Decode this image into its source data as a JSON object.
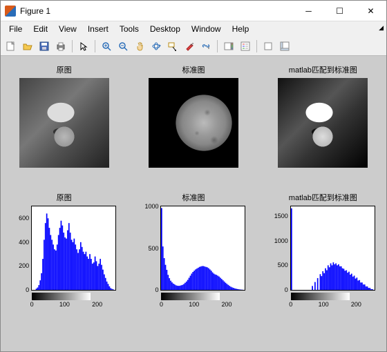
{
  "window": {
    "title": "Figure 1"
  },
  "menu": {
    "file": "File",
    "edit": "Edit",
    "view": "View",
    "insert": "Insert",
    "tools": "Tools",
    "desktop": "Desktop",
    "window": "Window",
    "help": "Help"
  },
  "subplots": {
    "img1": "原图",
    "img2": "标准图",
    "img3": "matlab匹配到标准图",
    "hist1": "原图",
    "hist2": "标准图",
    "hist3": "matlab匹配到标准图"
  },
  "chart_data": [
    {
      "type": "bar",
      "title": "原图",
      "xlabel": "",
      "ylabel": "",
      "xlim": [
        0,
        256
      ],
      "ylim": [
        0,
        700
      ],
      "xticks": [
        0,
        100,
        200
      ],
      "yticks": [
        0,
        200,
        400,
        600
      ],
      "x_step": 4,
      "x": [
        0,
        4,
        8,
        12,
        16,
        20,
        24,
        28,
        32,
        36,
        40,
        44,
        48,
        52,
        56,
        60,
        64,
        68,
        72,
        76,
        80,
        84,
        88,
        92,
        96,
        100,
        104,
        108,
        112,
        116,
        120,
        124,
        128,
        132,
        136,
        140,
        144,
        148,
        152,
        156,
        160,
        164,
        168,
        172,
        176,
        180,
        184,
        188,
        192,
        196,
        200,
        204,
        208,
        212,
        216,
        220,
        224,
        228,
        232,
        236,
        240,
        244,
        248,
        252
      ],
      "values": [
        0,
        0,
        0,
        10,
        20,
        40,
        80,
        140,
        260,
        420,
        560,
        640,
        600,
        520,
        460,
        420,
        380,
        340,
        330,
        380,
        460,
        520,
        580,
        540,
        480,
        440,
        430,
        500,
        560,
        480,
        420,
        400,
        430,
        380,
        340,
        310,
        340,
        400,
        360,
        320,
        300,
        320,
        280,
        260,
        300,
        260,
        220,
        230,
        280,
        240,
        200,
        220,
        260,
        210,
        170,
        130,
        100,
        70,
        50,
        30,
        15,
        8,
        4,
        0
      ]
    },
    {
      "type": "bar",
      "title": "标准图",
      "xlabel": "",
      "ylabel": "",
      "xlim": [
        0,
        256
      ],
      "ylim": [
        0,
        1000
      ],
      "xticks": [
        0,
        100,
        200
      ],
      "yticks": [
        0,
        500,
        1000
      ],
      "x_step": 4,
      "x": [
        0,
        4,
        8,
        12,
        16,
        20,
        24,
        28,
        32,
        36,
        40,
        44,
        48,
        52,
        56,
        60,
        64,
        68,
        72,
        76,
        80,
        84,
        88,
        92,
        96,
        100,
        104,
        108,
        112,
        116,
        120,
        124,
        128,
        132,
        136,
        140,
        144,
        148,
        152,
        156,
        160,
        164,
        168,
        172,
        176,
        180,
        184,
        188,
        192,
        196,
        200,
        204,
        208,
        212,
        216,
        220,
        224,
        228,
        232,
        236,
        240,
        244,
        248,
        252
      ],
      "values": [
        980,
        520,
        380,
        300,
        240,
        180,
        140,
        110,
        90,
        75,
        65,
        55,
        50,
        48,
        50,
        55,
        60,
        70,
        85,
        100,
        120,
        145,
        170,
        195,
        215,
        230,
        245,
        255,
        265,
        275,
        280,
        285,
        285,
        280,
        275,
        270,
        260,
        245,
        230,
        210,
        195,
        185,
        180,
        170,
        160,
        145,
        130,
        115,
        100,
        85,
        72,
        60,
        48,
        38,
        30,
        24,
        18,
        14,
        10,
        7,
        5,
        3,
        2,
        0
      ]
    },
    {
      "type": "bar",
      "title": "matlab匹配到标准图",
      "xlabel": "",
      "ylabel": "",
      "xlim": [
        0,
        256
      ],
      "ylim": [
        0,
        1700
      ],
      "xticks": [
        0,
        100,
        200
      ],
      "yticks": [
        0,
        500,
        1000,
        1500
      ],
      "x_step": 4,
      "x": [
        0,
        4,
        8,
        12,
        16,
        20,
        24,
        28,
        32,
        36,
        40,
        44,
        48,
        52,
        56,
        60,
        64,
        68,
        72,
        76,
        80,
        84,
        88,
        92,
        96,
        100,
        104,
        108,
        112,
        116,
        120,
        124,
        128,
        132,
        136,
        140,
        144,
        148,
        152,
        156,
        160,
        164,
        168,
        172,
        176,
        180,
        184,
        188,
        192,
        196,
        200,
        204,
        208,
        212,
        216,
        220,
        224,
        228,
        232,
        236,
        240,
        244,
        248,
        252
      ],
      "values": [
        1660,
        0,
        0,
        0,
        0,
        0,
        0,
        0,
        0,
        0,
        0,
        0,
        0,
        0,
        0,
        0,
        80,
        0,
        160,
        0,
        240,
        0,
        320,
        280,
        380,
        340,
        440,
        400,
        500,
        460,
        540,
        500,
        560,
        520,
        540,
        500,
        520,
        480,
        480,
        440,
        430,
        390,
        400,
        350,
        370,
        310,
        330,
        270,
        290,
        230,
        250,
        190,
        200,
        150,
        150,
        110,
        110,
        70,
        70,
        40,
        40,
        15,
        15,
        0
      ]
    }
  ]
}
